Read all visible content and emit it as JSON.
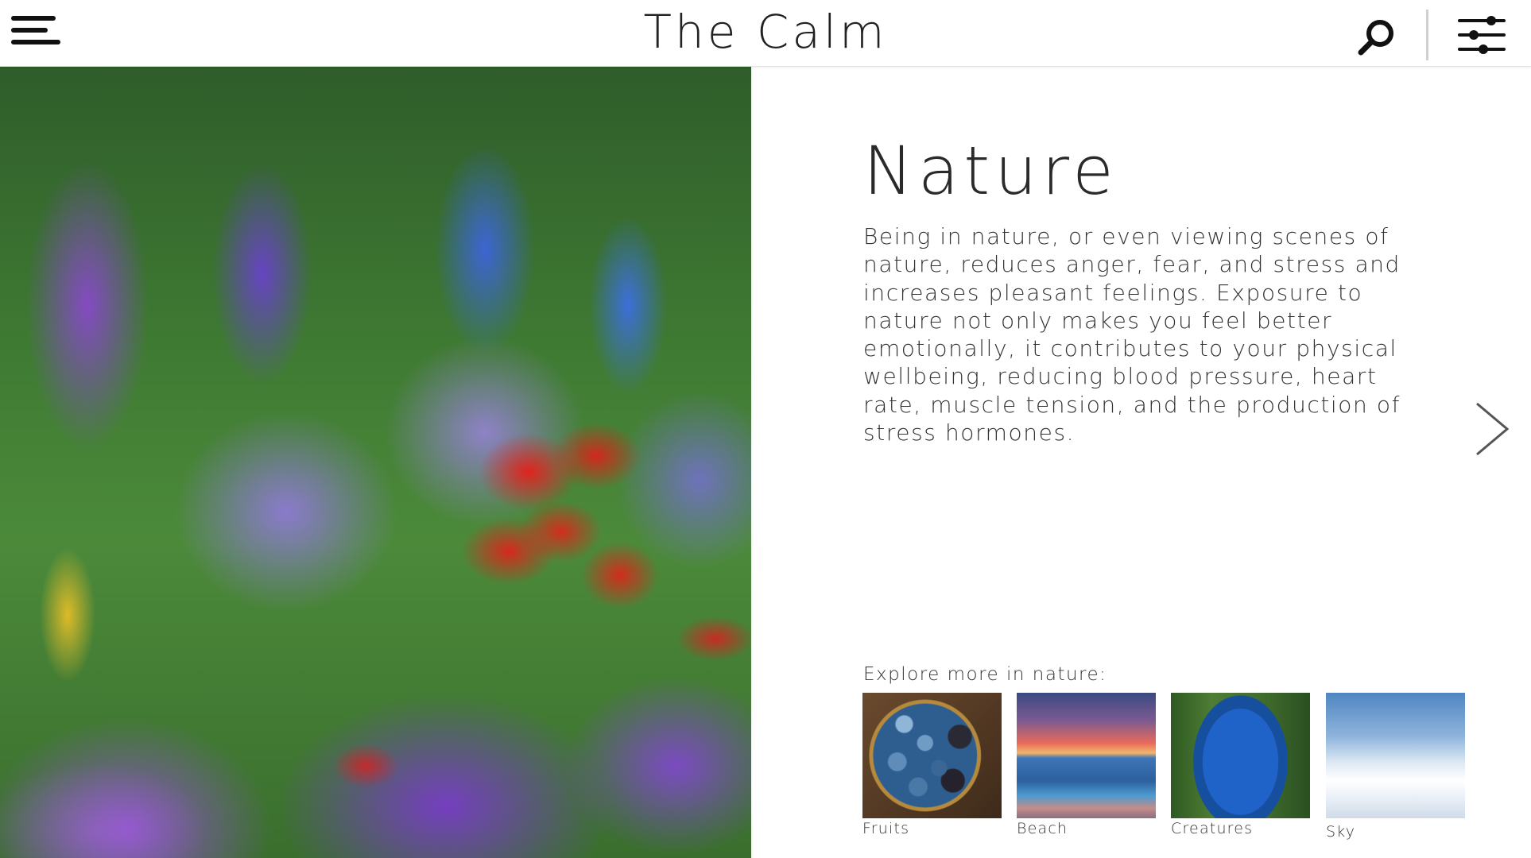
{
  "header": {
    "app_title": "The Calm",
    "menu_icon": "hamburger-menu-icon",
    "search_icon": "search-icon",
    "filter_icon": "sliders-filter-icon"
  },
  "hero": {
    "image_subject": "flower-garden-photo"
  },
  "content": {
    "title": "Nature",
    "body": "Being in nature, or even viewing scenes of nature, reduces anger, fear, and stress and increases pleasant feelings. Exposure to nature not only makes you feel better emotionally, it contributes to your physical wellbeing, reducing blood pressure, heart rate, muscle tension, and the production of stress hormones.",
    "next_icon": "chevron-right-icon"
  },
  "explore": {
    "label": "Explore more in nature:",
    "items": [
      {
        "label": "Fruits"
      },
      {
        "label": "Beach"
      },
      {
        "label": "Creatures"
      },
      {
        "label": "Sky"
      }
    ]
  },
  "colors": {
    "background": "#ffffff",
    "text": "#2a2a2a",
    "divider": "#cfcfcf"
  }
}
